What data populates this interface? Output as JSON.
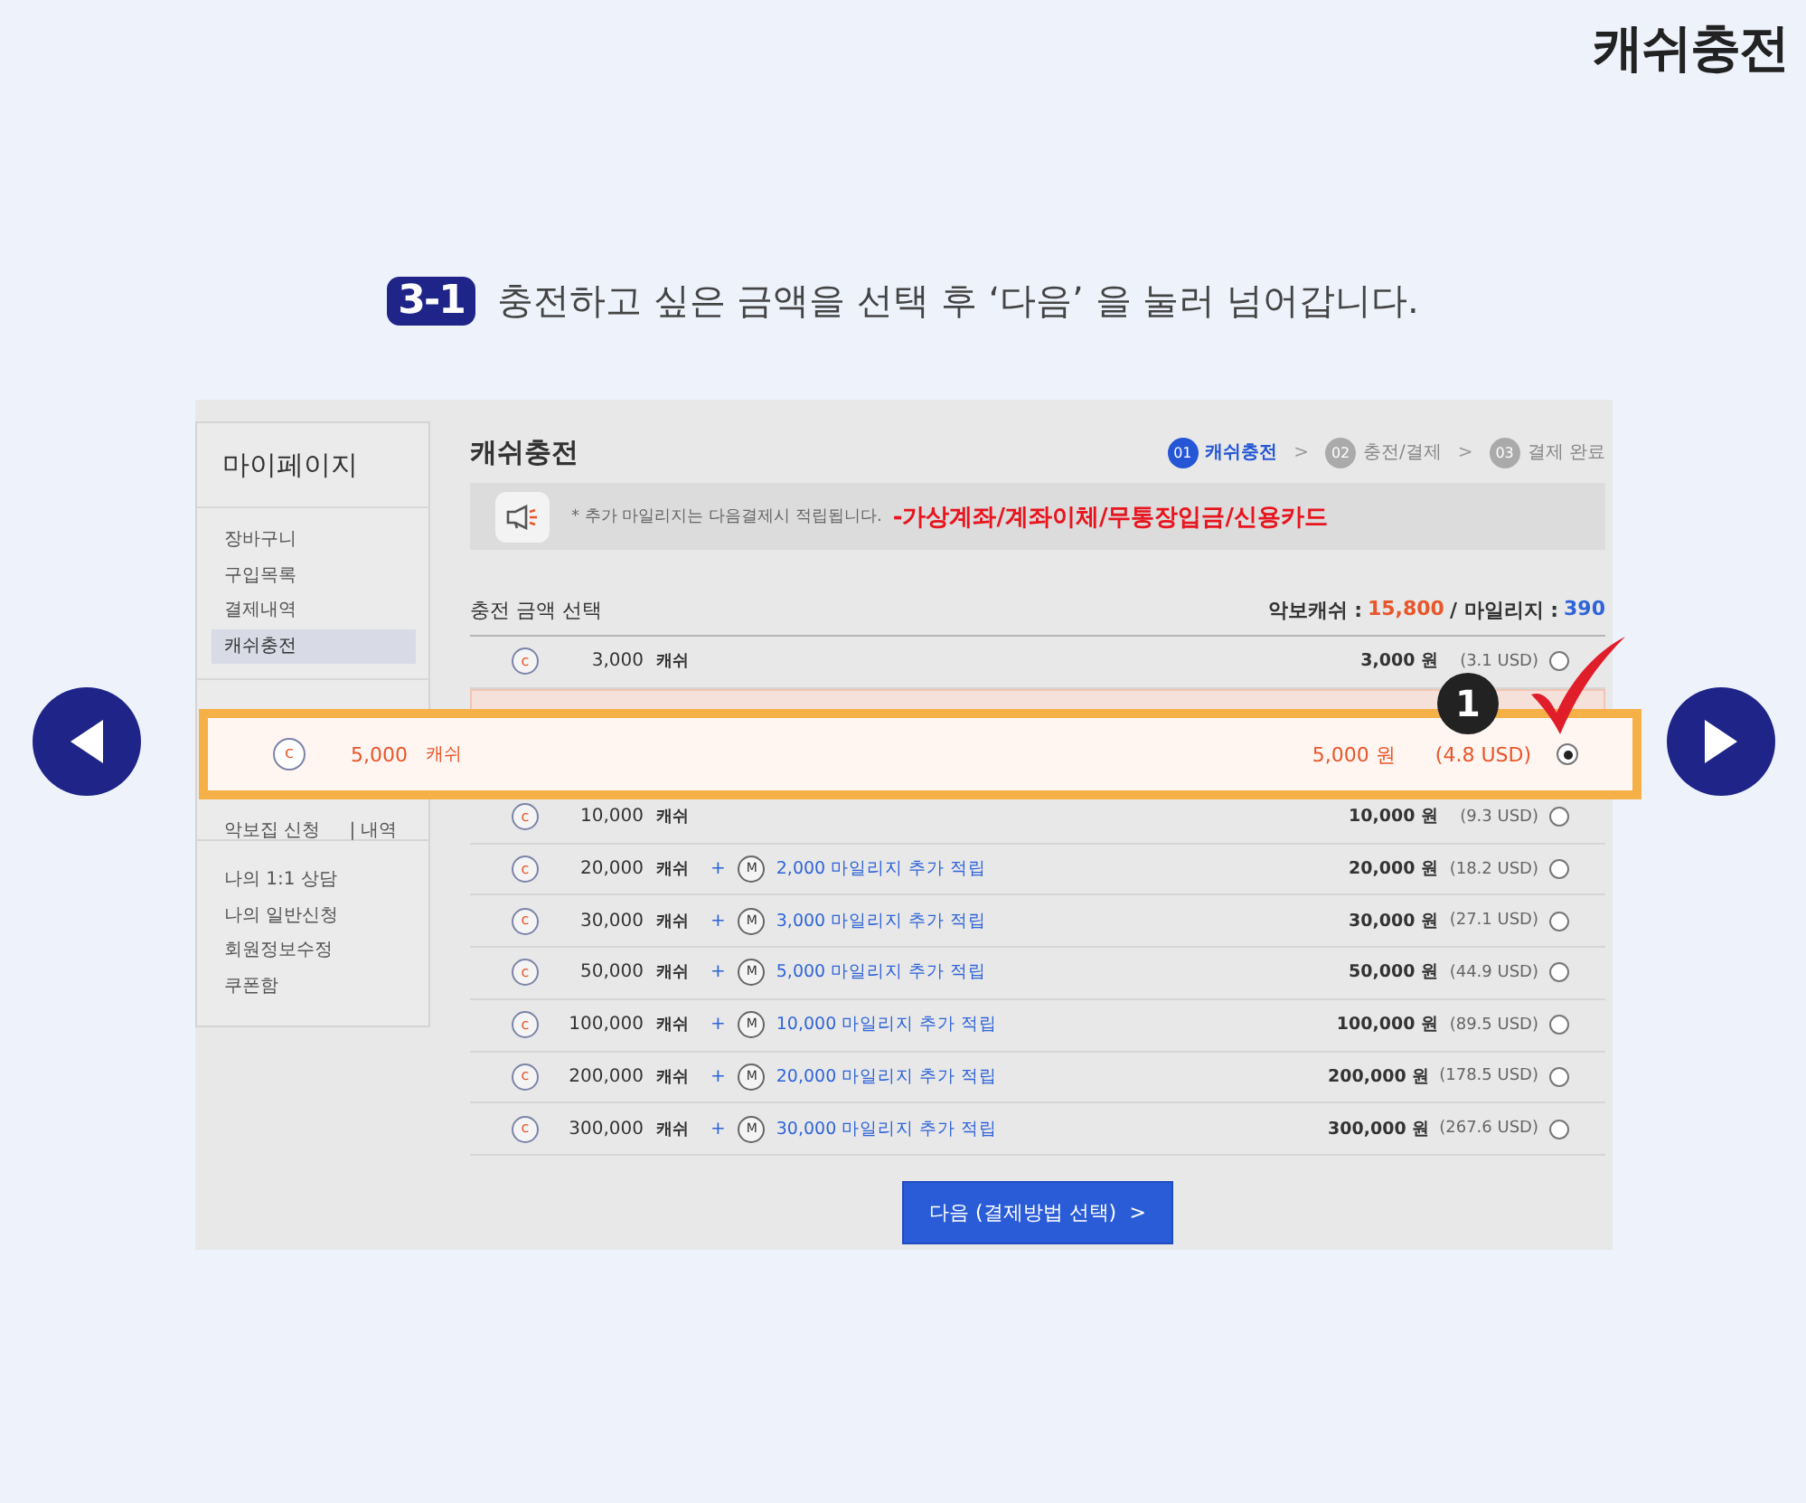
{
  "page_title": "캐쉬충전",
  "instruction": {
    "step": "3-1",
    "text": "충전하고 싶은 금액을 선택 후 ‘다음’ 을 눌러 넘어갑니다."
  },
  "sidebar": {
    "title": "마이페이지",
    "groups": [
      [
        {
          "label": "장바구니",
          "selected": false
        },
        {
          "label": "구입목록",
          "selected": false
        },
        {
          "label": "결제내역",
          "selected": false
        },
        {
          "label": "캐쉬충전",
          "selected": true
        }
      ],
      [
        {
          "label": "악보집 신청",
          "extra": "| 내역",
          "selected": false
        }
      ],
      [
        {
          "label": "나의 1:1 상담",
          "selected": false
        },
        {
          "label": "나의 일반신청",
          "selected": false
        },
        {
          "label": "회원정보수정",
          "selected": false
        },
        {
          "label": "쿠폰함",
          "selected": false
        }
      ]
    ]
  },
  "main": {
    "title": "캐쉬충전",
    "steps": [
      {
        "number": "01",
        "label": "캐쉬충전",
        "selected": true
      },
      {
        "number": "02",
        "label": "충전/결제",
        "selected": false
      },
      {
        "number": "03",
        "label": "결제 완료",
        "selected": false
      }
    ],
    "step_separator": ">",
    "notice": {
      "text": "* 추가 마일리지는 다음결제시 적립됩니다.",
      "highlight": "-가상계좌/계좌이체/무통장입금/신용카드"
    },
    "section_title": "충전 금액 선택",
    "balance": {
      "cash_label": "악보캐쉬 :",
      "cash_value": "15,800",
      "separator": "/ 마일리지 :",
      "mileage_value": "390"
    },
    "options": [
      {
        "kind": "plain",
        "cash_icon": "c",
        "amount": "3,000",
        "unit": "캐쉬",
        "price": "3,000 원",
        "usd": "(3.1 USD)",
        "selected": false
      },
      {
        "kind": "covered",
        "selected": true
      },
      {
        "kind": "plain",
        "cash_icon": "c",
        "amount": "10,000",
        "unit": "캐쉬",
        "price": "10,000 원",
        "usd": "(9.3 USD)",
        "selected": false
      },
      {
        "kind": "bonus",
        "cash_icon": "c",
        "amount": "20,000",
        "unit": "캐쉬",
        "plus": "+",
        "mileage_icon": "M",
        "bonus": "2,000 마일리지 추가 적립",
        "price": "20,000 원",
        "usd": "(18.2 USD)",
        "selected": false
      },
      {
        "kind": "bonus",
        "cash_icon": "c",
        "amount": "30,000",
        "unit": "캐쉬",
        "plus": "+",
        "mileage_icon": "M",
        "bonus": "3,000 마일리지 추가 적립",
        "price": "30,000 원",
        "usd": "(27.1 USD)",
        "selected": false
      },
      {
        "kind": "bonus",
        "cash_icon": "c",
        "amount": "50,000",
        "unit": "캐쉬",
        "plus": "+",
        "mileage_icon": "M",
        "bonus": "5,000 마일리지 추가 적립",
        "price": "50,000 원",
        "usd": "(44.9 USD)",
        "selected": false
      },
      {
        "kind": "bonus",
        "cash_icon": "c",
        "amount": "100,000",
        "unit": "캐쉬",
        "plus": "+",
        "mileage_icon": "M",
        "bonus": "10,000 마일리지 추가 적립",
        "price": "100,000 원",
        "usd": "(89.5 USD)",
        "selected": false
      },
      {
        "kind": "bonus",
        "cash_icon": "c",
        "amount": "200,000",
        "unit": "캐쉬",
        "plus": "+",
        "mileage_icon": "M",
        "bonus": "20,000 마일리지 추가 적립",
        "price": "200,000 원",
        "usd": "(178.5 USD)",
        "selected": false
      },
      {
        "kind": "bonus",
        "cash_icon": "c",
        "amount": "300,000",
        "unit": "캐쉬",
        "plus": "+",
        "mileage_icon": "M",
        "bonus": "30,000 마일리지 추가 적립",
        "price": "300,000 원",
        "usd": "(267.6 USD)",
        "selected": false
      }
    ],
    "next_button": {
      "label": "다음 (결제방법 선택)",
      "arrow": ">"
    }
  },
  "callout": {
    "cash_icon": "c",
    "amount": "5,000",
    "unit": "캐쉬",
    "price": "5,000 원",
    "usd": "(4.8 USD)",
    "selected": true,
    "badge": "1"
  }
}
